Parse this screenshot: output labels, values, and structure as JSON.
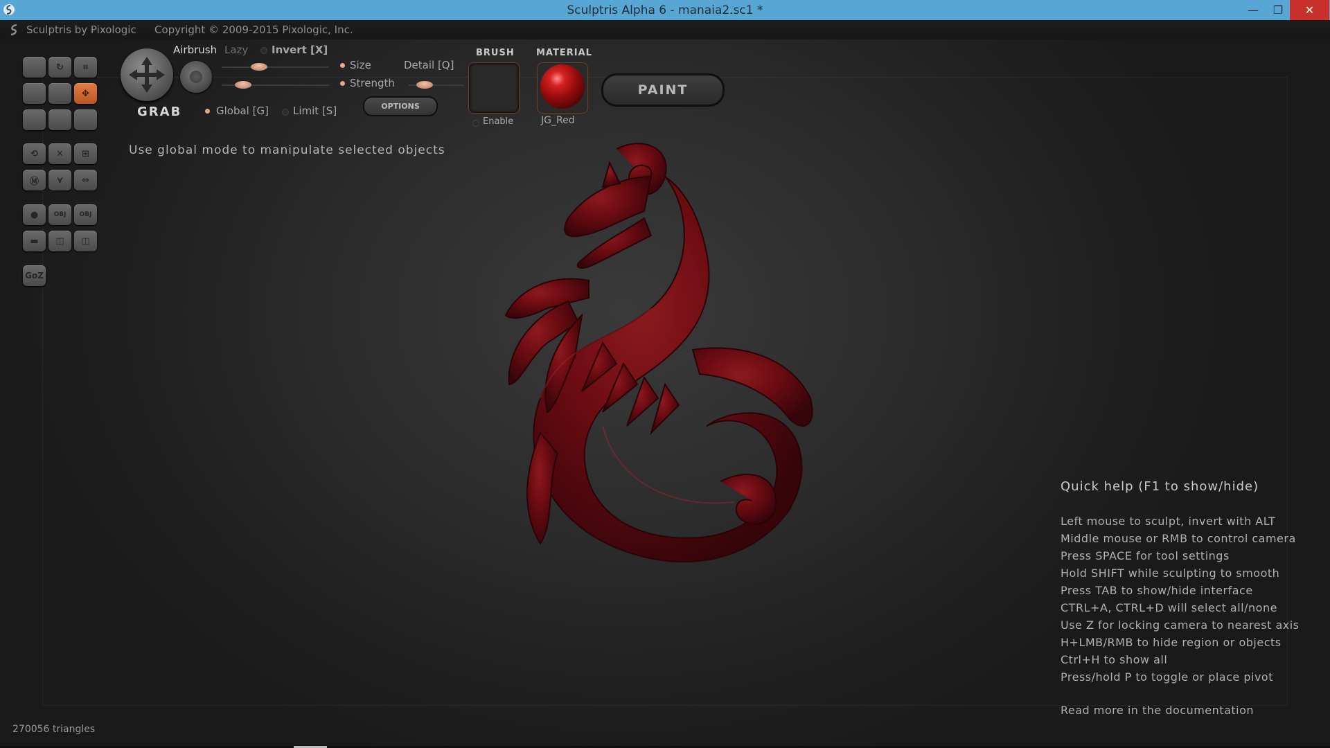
{
  "window": {
    "title": "Sculptris Alpha 6 - manaia2.sc1 *",
    "minimize": "—",
    "maximize": "❐",
    "close": "✕"
  },
  "menubar": {
    "brand": "Sculptris by Pixologic",
    "copyright": "Copyright © 2009-2015 Pixologic, Inc."
  },
  "palette": {
    "buttons": [
      {
        "name": "draw-tool",
        "glyph": "",
        "active": false
      },
      {
        "name": "rotate-tool",
        "glyph": "↻",
        "active": false
      },
      {
        "name": "crop-tool",
        "glyph": "⌗",
        "active": false
      },
      {
        "name": "flatten-tool",
        "glyph": "",
        "active": false
      },
      {
        "name": "inflate-tool",
        "glyph": "",
        "active": false
      },
      {
        "name": "grab-tool",
        "glyph": "✥",
        "active": true
      },
      {
        "name": "pinch-tool",
        "glyph": "",
        "active": false
      },
      {
        "name": "crease-tool",
        "glyph": "",
        "active": false
      },
      {
        "name": "smooth-tool",
        "glyph": "",
        "active": false
      },
      {
        "name": "symmetry-tool",
        "glyph": "⟲",
        "active": false
      },
      {
        "name": "wireframe-tool",
        "glyph": "✕",
        "active": false
      },
      {
        "name": "grid-tool",
        "glyph": "⊞",
        "active": false
      },
      {
        "name": "mask-tool",
        "glyph": "Ⓜ",
        "active": false
      },
      {
        "name": "reduce-tool",
        "glyph": "⋎",
        "active": false
      },
      {
        "name": "mirror-tool",
        "glyph": "⇔",
        "active": false
      },
      {
        "name": "sphere-tool",
        "glyph": "●",
        "active": false
      },
      {
        "name": "import-obj",
        "glyph": "OBJ",
        "active": false
      },
      {
        "name": "export-obj",
        "glyph": "OBJ",
        "active": false
      },
      {
        "name": "plane-tool",
        "glyph": "▬",
        "active": false
      },
      {
        "name": "open-file",
        "glyph": "◫",
        "active": false
      },
      {
        "name": "save-file",
        "glyph": "◫",
        "active": false
      },
      {
        "name": "goz-button",
        "glyph": "GoZ",
        "active": false
      }
    ]
  },
  "brush": {
    "tool_name": "GRAB",
    "airbrush": "Airbrush",
    "lazy": "Lazy",
    "invert": "Invert [X]",
    "size": "Size",
    "strength": "Strength",
    "detail": "Detail [Q]",
    "global": "Global [G]",
    "limit": "Limit [S]",
    "options": "OPTIONS",
    "size_level": 0.35,
    "strength_level": 0.2
  },
  "brush_panel": {
    "header": "BRUSH",
    "enable": "Enable"
  },
  "material_panel": {
    "header": "MATERIAL",
    "name": "JG_Red",
    "color": "#b81818"
  },
  "paint_button": "PAINT",
  "hint": "Use global mode to manipulate selected objects",
  "quick_help": {
    "title": "Quick help (F1 to show/hide)",
    "lines": [
      "Left mouse to sculpt, invert with ALT",
      "Middle mouse or RMB to control camera",
      "Press SPACE for tool settings",
      "Hold SHIFT while sculpting to smooth",
      "Press TAB to show/hide interface",
      "CTRL+A, CTRL+D will select all/none",
      "Use Z for locking camera to nearest axis",
      "H+LMB/RMB to hide region or objects",
      "Ctrl+H to show all",
      "Press/hold P to toggle or place pivot"
    ],
    "more": "Read more in the documentation"
  },
  "status": {
    "triangles": "270056 triangles"
  },
  "colors": {
    "accent": "#58a6d3",
    "active_tool": "#d06a35",
    "model": "#6b0c12"
  }
}
